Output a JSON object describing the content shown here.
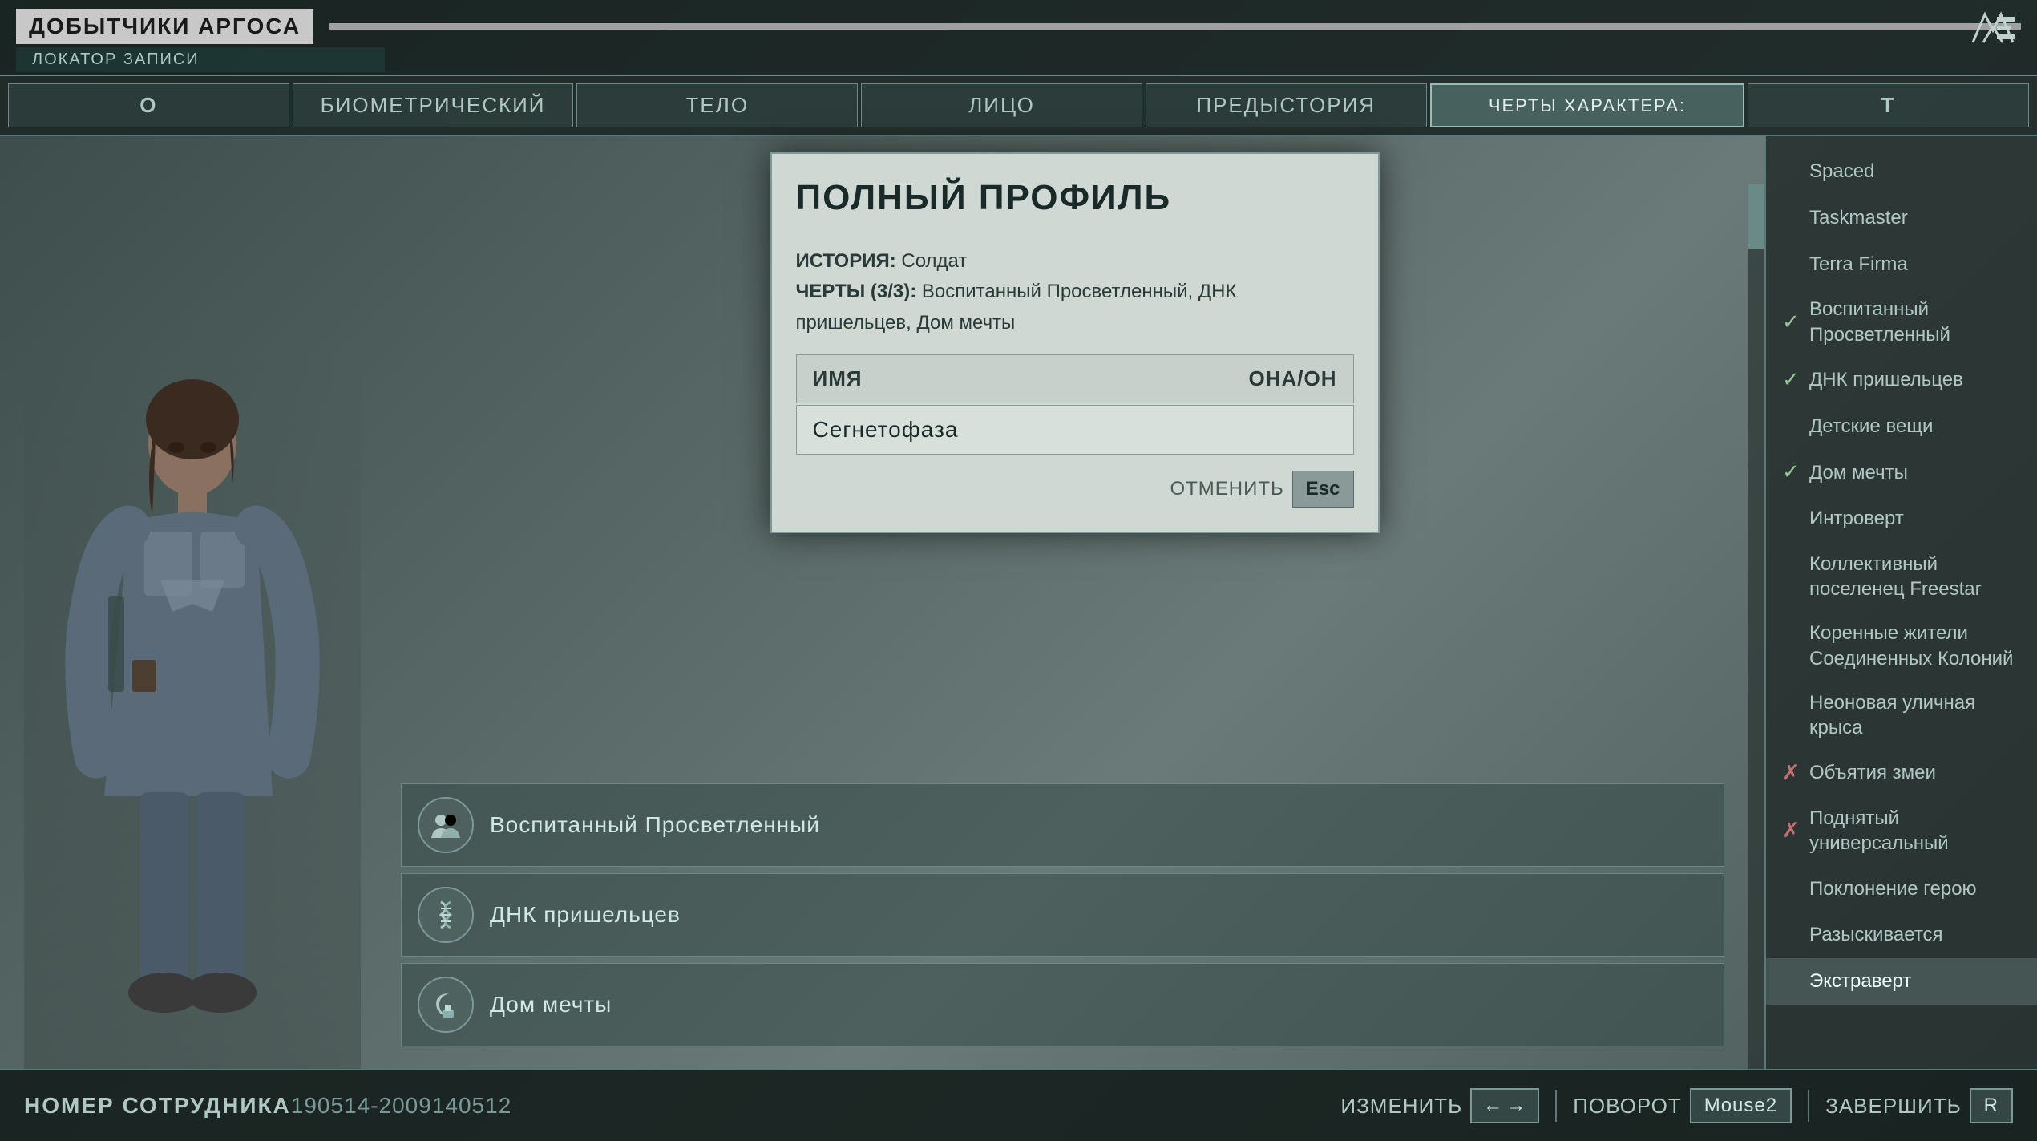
{
  "app": {
    "title": "ДОБЫТЧИКИ АРГОСА",
    "subtitle": "ЛОКАТОР ЗАПИСИ",
    "logo_alt": "AE-logo"
  },
  "nav": {
    "key_left": "O",
    "key_right": "T",
    "tabs": [
      {
        "label": "БИОМЕТРИЧЕСКИЙ",
        "active": false
      },
      {
        "label": "ТЕЛО",
        "active": false
      },
      {
        "label": "ЛИЦО",
        "active": false
      },
      {
        "label": "ПРЕДЫСТОРИЯ",
        "active": false
      },
      {
        "label": "ЧЕРТЫ ХАРАКТЕРА:",
        "active": true
      }
    ]
  },
  "character": {
    "trait_header": "Экстраверт"
  },
  "modal": {
    "title": "ПОЛНЫЙ ПРОФИЛЬ",
    "history_label": "ИСТОРИЯ:",
    "history_value": "Солдат",
    "traits_label": "ЧЕРТЫ (3/3):",
    "traits_value": "Воспитанный Просветленный, ДНК пришельцев, Дом мечты",
    "name_label": "ИМЯ",
    "pronoun_label": "ОНА/ОН",
    "name_value": "Сегнетофаза",
    "cancel_label": "ОТМЕНИТЬ",
    "cancel_key": "Esc"
  },
  "traits_list": [
    {
      "icon": "👥",
      "name": "Воспитанный Просветленный",
      "icon_type": "people"
    },
    {
      "icon": "🧬",
      "name": "ДНК пришельцев",
      "icon_type": "dna"
    },
    {
      "icon": "🌙",
      "name": "Дом мечты",
      "icon_type": "moon"
    }
  ],
  "sidebar": {
    "items": [
      {
        "label": "Spaced",
        "status": "none"
      },
      {
        "label": "Taskmaster",
        "status": "none"
      },
      {
        "label": "Terra Firma",
        "status": "none"
      },
      {
        "label": "Воспитанный Просветленный",
        "small": "",
        "status": "check"
      },
      {
        "label": "ДНК пришельцев",
        "status": "check"
      },
      {
        "label": "Детские вещи",
        "status": "none"
      },
      {
        "label": "Дом мечты",
        "status": "check"
      },
      {
        "label": "Интроверт",
        "status": "none"
      },
      {
        "label": "Коллективный поселенец Freestar",
        "small": "",
        "status": "none"
      },
      {
        "label": "Коренные жители Соединенных Колоний",
        "small": "",
        "status": "none"
      },
      {
        "label": "Неоновая уличная крыса",
        "status": "none"
      },
      {
        "label": "Объятия змеи",
        "status": "cross"
      },
      {
        "label": "Поднятый универсальный",
        "small": "",
        "status": "cross"
      },
      {
        "label": "Поклонение герою",
        "status": "none"
      },
      {
        "label": "Разыскивается",
        "status": "none"
      },
      {
        "label": "Экстраверт",
        "status": "selected"
      }
    ]
  },
  "bottom": {
    "employee_label": "НОМЕР СОТРУДНИКА",
    "employee_number": "190514-2009140512",
    "change_label": "ИЗМЕНИТЬ",
    "change_keys": [
      "←",
      "→"
    ],
    "rotation_label": "ПОВОРОТ",
    "rotation_key": "Mouse2",
    "finish_label": "ЗАВЕРШИТЬ",
    "finish_key": "R"
  }
}
